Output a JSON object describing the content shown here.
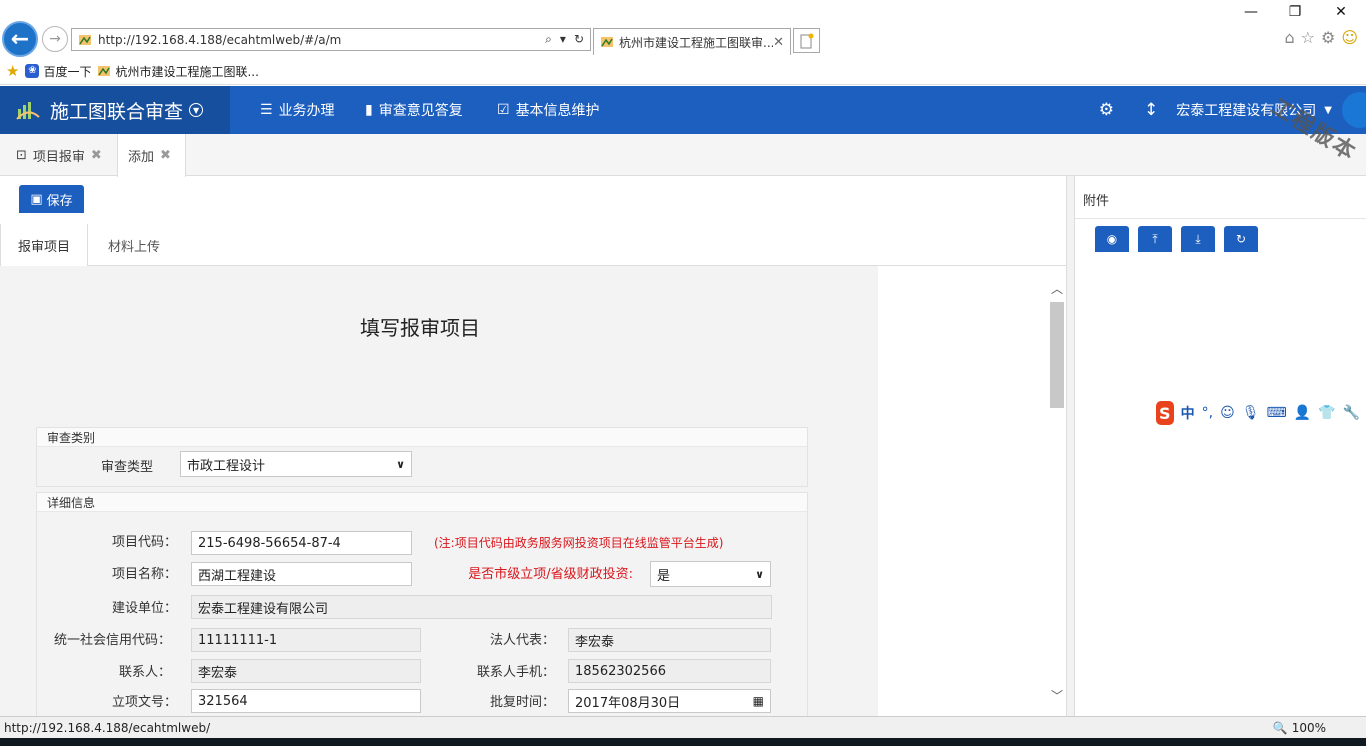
{
  "browser": {
    "url": "http://192.168.4.188/ecahtmlweb/#/a/m",
    "tab_title": "杭州市建设工程施工图联审...",
    "favorites": [
      "百度一下",
      "杭州市建设工程施工图联..."
    ],
    "status_url": "http://192.168.4.188/ecahtmlweb/",
    "zoom": "100%"
  },
  "header": {
    "title": "施工图联合审查",
    "nav": [
      "业务办理",
      "审查意见答复",
      "基本信息维护"
    ],
    "company": "宏泰工程建设有限公司",
    "watermark": "工程版本",
    "brand_color": "#1d5fbf"
  },
  "page_tabs": [
    {
      "label": "项目报审"
    },
    {
      "label": "添加"
    }
  ],
  "toolbar": {
    "save_label": "保存"
  },
  "form_tabs": [
    "报审项目",
    "材料上传"
  ],
  "form": {
    "heading": "填写报审项目",
    "section_type": {
      "legend": "审查类别",
      "label": "审查类型",
      "value": "市政工程设计"
    },
    "section_detail": {
      "legend": "详细信息",
      "project_code_label": "项目代码：",
      "project_code": "215-6498-56654-87-4",
      "project_code_note": "(注:项目代码由政务服务网投资项目在线监管平台生成)",
      "project_name_label": "项目名称：",
      "project_name": "西湖工程建设",
      "city_invest_label": "是否市级立项/省级财政投资:",
      "city_invest": "是",
      "builder_label": "建设单位：",
      "builder": "宏泰工程建设有限公司",
      "credit_code_label": "统一社会信用代码：",
      "credit_code": "11111111-1",
      "legal_rep_label": "法人代表：",
      "legal_rep": "李宏泰",
      "contact_label": "联系人：",
      "contact": "李宏泰",
      "contact_phone_label": "联系人手机：",
      "contact_phone": "18562302566",
      "approval_no_label": "立项文号：",
      "approval_no": "321564",
      "approval_date_label": "批复时间：",
      "approval_date": "2017年08月30日"
    }
  },
  "side": {
    "title": "附件"
  },
  "ime": {
    "mode": "中"
  }
}
